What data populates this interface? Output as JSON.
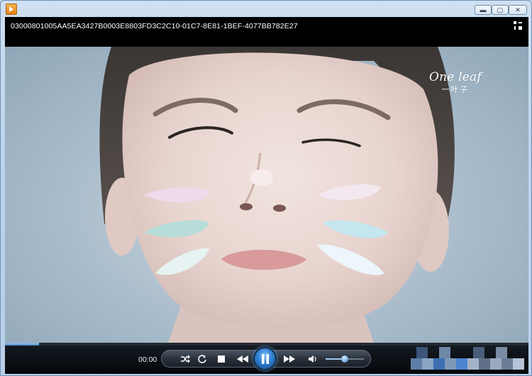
{
  "window": {
    "minimize_label": "▬",
    "maximize_label": "▢",
    "close_label": "✕"
  },
  "player": {
    "file_title": "03000801005AA5EA3427B0003E8803FD3C2C10-01C7-8E81-1BEF-4077BB782E27",
    "watermark_main": "One leaf",
    "watermark_sub": "一叶子",
    "current_time": "00:00",
    "progress_fraction": 0.065,
    "volume_fraction": 0.5,
    "accent_color": "#4a86c4",
    "icons": [
      "switch-view-icon",
      "shuffle-icon",
      "repeat-icon",
      "stop-icon",
      "rewind-icon",
      "pause-icon",
      "fast-forward-icon",
      "volume-icon"
    ]
  }
}
